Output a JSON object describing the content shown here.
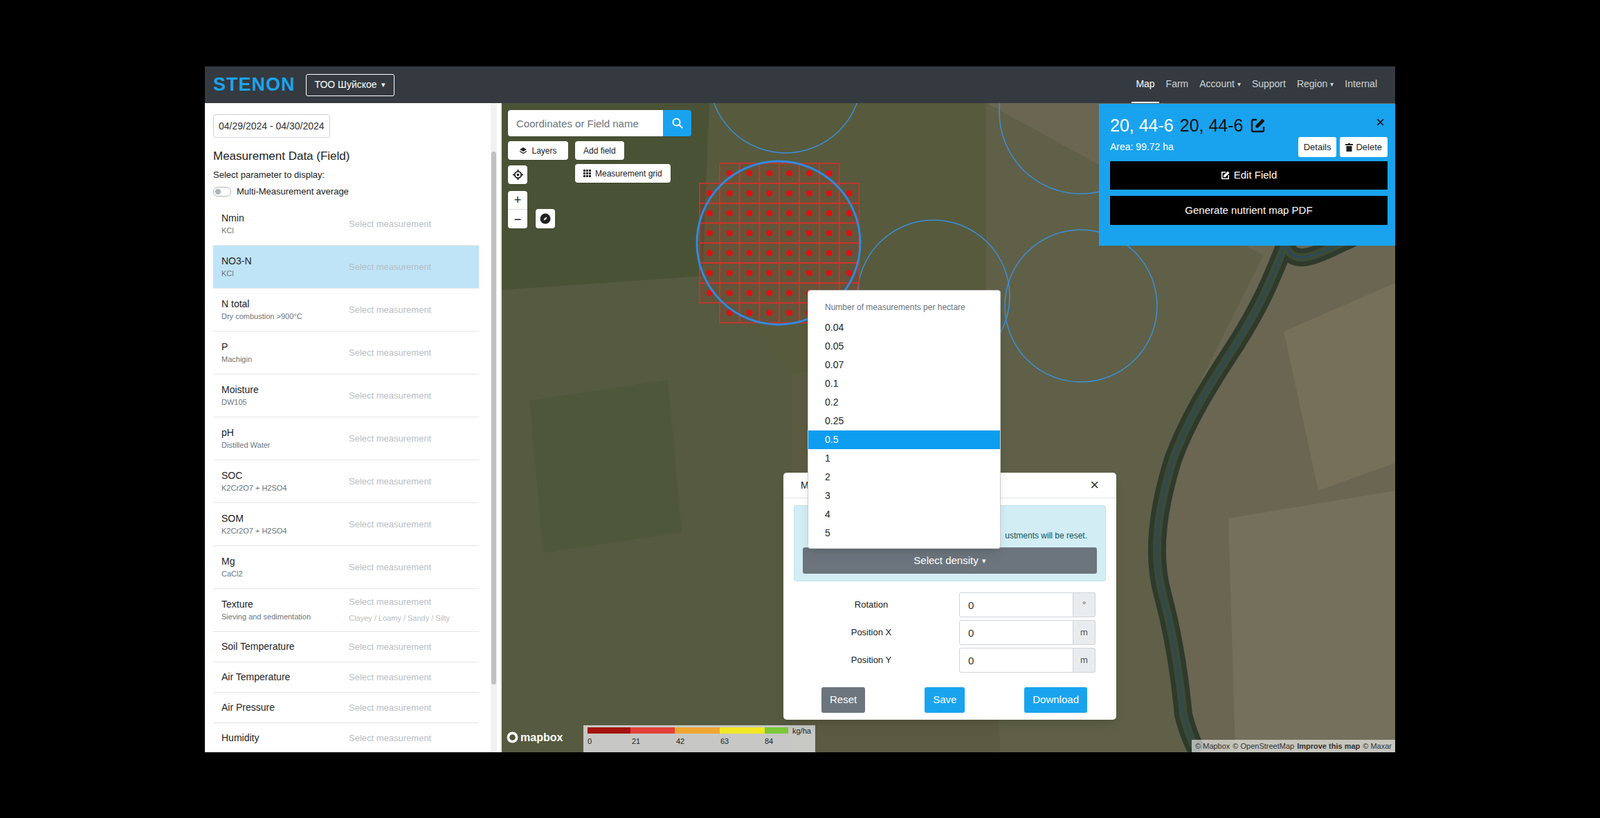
{
  "nav": {
    "logo": "STENON",
    "org": {
      "label": "ТОО Шуйское",
      "caret": "▾"
    },
    "links": [
      {
        "label": "Map",
        "selected": true
      },
      {
        "label": "Farm",
        "selected": false
      },
      {
        "label": "Account",
        "caret": "▾",
        "selected": false
      },
      {
        "label": "Support",
        "selected": false
      },
      {
        "label": "Region",
        "caret": "▾",
        "selected": false
      },
      {
        "label": "Internal",
        "selected": false
      }
    ]
  },
  "sidebar": {
    "date_range": "04/29/2024 - 04/30/2024",
    "title": "Measurement Data (Field)",
    "prompt": "Select parameter to display:",
    "toggle": {
      "label": "Multi-Measurement average",
      "on": false
    },
    "parameters": [
      {
        "name": "Nmin",
        "method": "KCl",
        "placeholder": "Select measurement",
        "selected": false
      },
      {
        "name": "NO3-N",
        "method": "KCl",
        "placeholder": "Select measurement",
        "selected": true
      },
      {
        "name": "N total",
        "method": "Dry combustion >900°C",
        "placeholder": "Select measurement",
        "selected": false
      },
      {
        "name": "P",
        "method": "Machigin",
        "placeholder": "Select measurement",
        "selected": false
      },
      {
        "name": "Moisture",
        "method": "DW105",
        "placeholder": "Select measurement",
        "selected": false
      },
      {
        "name": "pH",
        "method": "Distilled Water",
        "placeholder": "Select measurement",
        "selected": false
      },
      {
        "name": "SOC",
        "method": "K2Cr2O7 + H2SO4",
        "placeholder": "Select measurement",
        "selected": false
      },
      {
        "name": "SOM",
        "method": "K2Cr2O7 + H2SO4",
        "placeholder": "Select measurement",
        "selected": false
      },
      {
        "name": "Mg",
        "method": "CaCl2",
        "placeholder": "Select measurement",
        "selected": false
      },
      {
        "name": "Texture",
        "method": "Sieving and sedimentation",
        "placeholder": "Select measurement",
        "hint": "Clayey / Loamy / Sandy / Silty",
        "selected": false
      },
      {
        "name": "Soil Temperature",
        "placeholder": "Select measurement",
        "selected": false
      },
      {
        "name": "Air Temperature",
        "placeholder": "Select measurement",
        "selected": false
      },
      {
        "name": "Air Pressure",
        "placeholder": "Select measurement",
        "selected": false
      },
      {
        "name": "Humidity",
        "placeholder": "Select measurement",
        "selected": false
      }
    ]
  },
  "map": {
    "search": {
      "placeholder": "Coordinates or Field name"
    },
    "buttons": {
      "layers": "Layers",
      "add_field": "Add field",
      "grid": "Measurement grid"
    },
    "zoom_in": "+",
    "zoom_out": "−",
    "logo": "mapbox",
    "attribution": {
      "mapbox": "© Mapbox",
      "osm": "© OpenStreetMap",
      "improve": "Improve this map",
      "maxar": "© Maxar"
    },
    "legend": {
      "ticks": [
        "0",
        "21",
        "42",
        "63",
        "84"
      ],
      "unit": "kg/ha"
    }
  },
  "field_panel": {
    "name": "20, 44-6",
    "name_editable": "20, 44-6",
    "close": "×",
    "area": "Area: 99.72 ha",
    "details": "Details",
    "delete": "Delete",
    "edit": "Edit Field",
    "generate": "Generate nutrient map PDF"
  },
  "grid_modal": {
    "title": "M",
    "close": "×",
    "notice": "ustments will be reset.",
    "density_button": "Select density",
    "caret": "▾",
    "fields": [
      {
        "label": "Rotation",
        "value": "0",
        "unit": "°"
      },
      {
        "label": "Position X",
        "value": "0",
        "unit": "m"
      },
      {
        "label": "Position Y",
        "value": "0",
        "unit": "m"
      }
    ],
    "buttons": {
      "reset": "Reset",
      "save": "Save",
      "download": "Download"
    }
  },
  "density_menu": {
    "header": "Number of measurements per hectare",
    "options": [
      {
        "label": "0.04",
        "selected": false
      },
      {
        "label": "0.05",
        "selected": false
      },
      {
        "label": "0.07",
        "selected": false
      },
      {
        "label": "0.1",
        "selected": false
      },
      {
        "label": "0.2",
        "selected": false
      },
      {
        "label": "0.25",
        "selected": false
      },
      {
        "label": "0.5",
        "selected": true
      },
      {
        "label": "1",
        "selected": false
      },
      {
        "label": "2",
        "selected": false
      },
      {
        "label": "3",
        "selected": false
      },
      {
        "label": "4",
        "selected": false
      },
      {
        "label": "5",
        "selected": false
      }
    ]
  }
}
